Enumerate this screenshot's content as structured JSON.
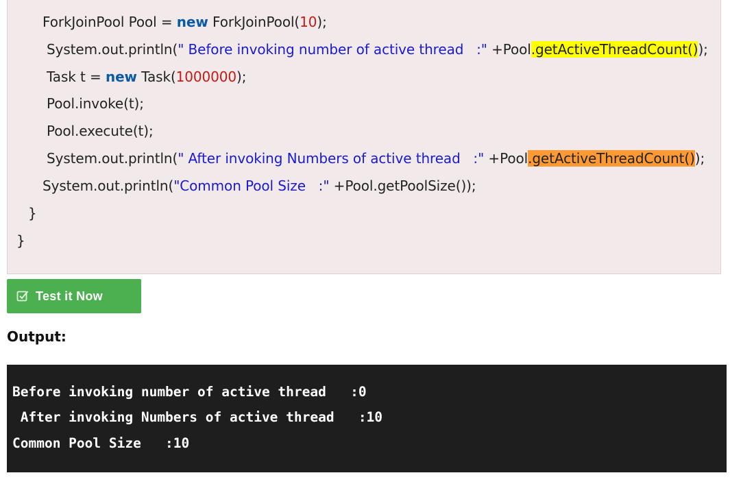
{
  "code": {
    "line1": {
      "pre": "ForkJoinPool Pool = ",
      "kw": "new",
      "mid": " ForkJoinPool(",
      "num": "10",
      "post": ");"
    },
    "line2": {
      "pre": "System.out.println(",
      "str": "\" Before invoking number of active thread   :\"",
      "mid": " +Pool",
      "hl": ".getActiveThreadCount()",
      "post": ");"
    },
    "line3": {
      "pre": "Task t = ",
      "kw": "new",
      "mid": " Task(",
      "num": "1000000",
      "post": ");"
    },
    "line4": {
      "text": "Pool.invoke(t);"
    },
    "line5": {
      "text": "Pool.execute(t);"
    },
    "line6": {
      "pre": "System.out.println(",
      "str": "\" After invoking Numbers of active thread   :\"",
      "mid": " +Pool",
      "hl": ".getActiveThreadCount()",
      "post": ");"
    },
    "line7": {
      "pre": "System.out.println(",
      "str": "\"Common Pool Size   :\"",
      "post": " +Pool.getPoolSize());"
    },
    "line8": {
      "text": "}"
    },
    "line9": {
      "text": "}"
    }
  },
  "test_button": {
    "label": "Test it Now",
    "icon": "edit-check-icon",
    "color": "#4caf50"
  },
  "output_heading": "Output:",
  "console": {
    "lines": [
      "Before invoking number of active thread   :0",
      " After invoking Numbers of active thread   :10",
      "Common Pool Size   :10"
    ]
  },
  "colors": {
    "keyword": "#0a5aa6",
    "string": "#1a1ad0",
    "number": "#c41a16",
    "highlight_yellow": "#ffff00",
    "highlight_orange": "#ff9933",
    "code_background": "#f2eaea",
    "console_background": "#1e1e1e"
  }
}
